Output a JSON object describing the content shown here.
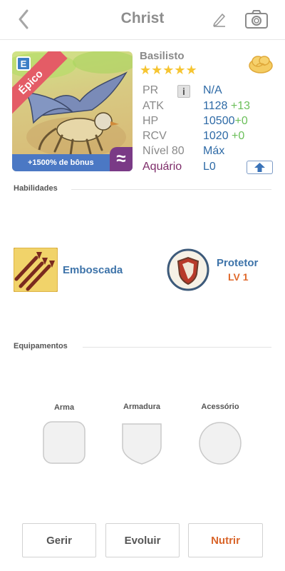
{
  "header": {
    "title": "Christ",
    "back_icon": "chevron-left-icon",
    "edit_icon": "pencil-icon",
    "camera_icon": "camera-icon"
  },
  "card": {
    "rarity": "Épico",
    "type_icon_letter": "E",
    "bonus_text": "+1500% de bônus",
    "element_symbol": "≈",
    "colors": {
      "rarity": "#e45c66",
      "bonus_bar": "#4b78c4",
      "element": "#7a3a86"
    }
  },
  "unit": {
    "name": "Basilisto",
    "stars": "★★★★★",
    "star_count": 5,
    "cloud_icon": "cloud-icon"
  },
  "stats": {
    "pr": {
      "label": "PR",
      "value": "N/A"
    },
    "atk": {
      "label": "ATK",
      "value": "1128",
      "bonus": " +13"
    },
    "hp": {
      "label": "HP",
      "value": "10500",
      "bonus": "+0"
    },
    "rcv": {
      "label": "RCV",
      "value": "1020",
      "bonus": " +0"
    },
    "level": {
      "label": "Nível 80",
      "value": "Máx"
    },
    "aquario": {
      "label": "Aquário",
      "value": "L0"
    }
  },
  "skills_section": {
    "title": "Habilidades",
    "skills": [
      {
        "name": "Emboscada",
        "icon": "arrows-icon"
      },
      {
        "name": "Protetor",
        "level": "LV 1",
        "icon": "shield-icon"
      }
    ]
  },
  "equip_section": {
    "title": "Equipamentos",
    "slots": [
      {
        "label": "Arma",
        "icon": "weapon-slot-icon"
      },
      {
        "label": "Armadura",
        "icon": "armor-slot-icon"
      },
      {
        "label": "Acessório",
        "icon": "accessory-slot-icon"
      }
    ]
  },
  "buttons": {
    "manage": "Gerir",
    "evolve": "Evoluir",
    "feed": "Nutrir"
  },
  "colors": {
    "stat_value": "#2e6aa6",
    "stat_bonus": "#6bbf5a",
    "skill_name": "#3d73a9",
    "skill_level": "#e06a2d",
    "feed_button": "#d9652a"
  }
}
